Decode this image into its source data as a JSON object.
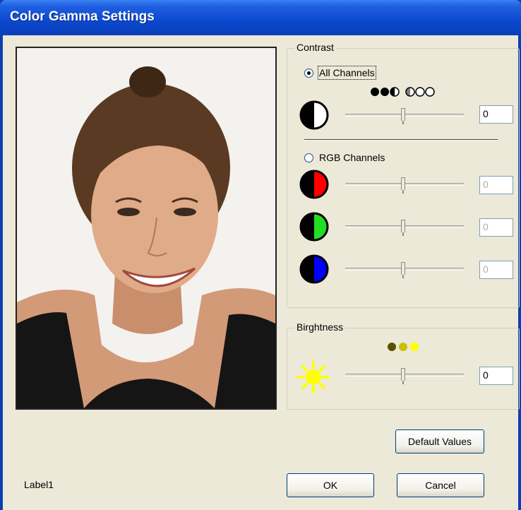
{
  "window": {
    "title": "Color Gamma Settings"
  },
  "contrast": {
    "legend": "Contrast",
    "all_channels": {
      "label": "All Channels",
      "selected": true,
      "value": "0"
    },
    "rgb_channels": {
      "label": "RGB Channels",
      "selected": false,
      "red_value": "0",
      "green_value": "0",
      "blue_value": "0"
    }
  },
  "brightness": {
    "legend": "Birghtness",
    "value": "0"
  },
  "buttons": {
    "default_values": "Default Values",
    "ok": "OK",
    "cancel": "Cancel"
  },
  "status": {
    "label": "Label1"
  },
  "colors": {
    "red": "#ff0000",
    "green": "#22dd22",
    "blue": "#0000ff",
    "sun": "#ffff00"
  }
}
